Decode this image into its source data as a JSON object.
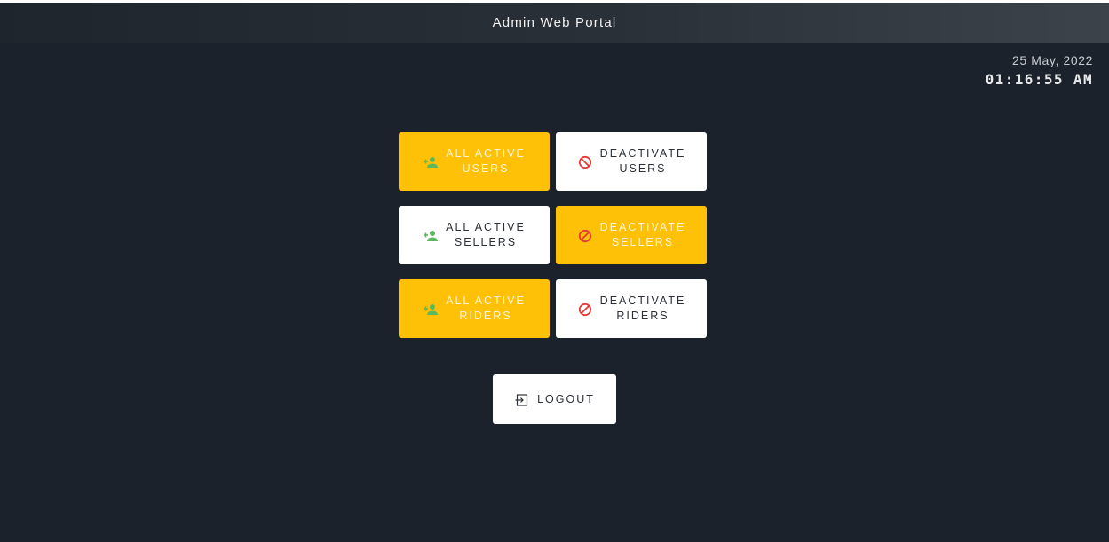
{
  "header": {
    "title": "Admin Web Portal"
  },
  "datetime": {
    "date": "25 May, 2022",
    "time": "01:16:55 AM"
  },
  "buttons": {
    "active_users": {
      "line1": "ALL ACTIVE",
      "line2": "USERS"
    },
    "deactivate_users": {
      "line1": "DEACTIVATE",
      "line2": "USERS"
    },
    "active_sellers": {
      "line1": "ALL ACTIVE",
      "line2": "SELLERS"
    },
    "deactivate_sellers": {
      "line1": "DEACTIVATE",
      "line2": "SELLERS"
    },
    "active_riders": {
      "line1": "ALL ACTIVE",
      "line2": "RIDERS"
    },
    "deactivate_riders": {
      "line1": "DEACTIVATE",
      "line2": "RIDERS"
    },
    "logout": {
      "label": "LOGOUT"
    }
  },
  "icons": {
    "active": "person-add-icon",
    "deactivate": "block-icon",
    "logout": "logout-icon"
  },
  "colors": {
    "background": "#1c222b",
    "accent_yellow": "#ffc107",
    "icon_green": "#5cb85c",
    "icon_red": "#e53935"
  }
}
